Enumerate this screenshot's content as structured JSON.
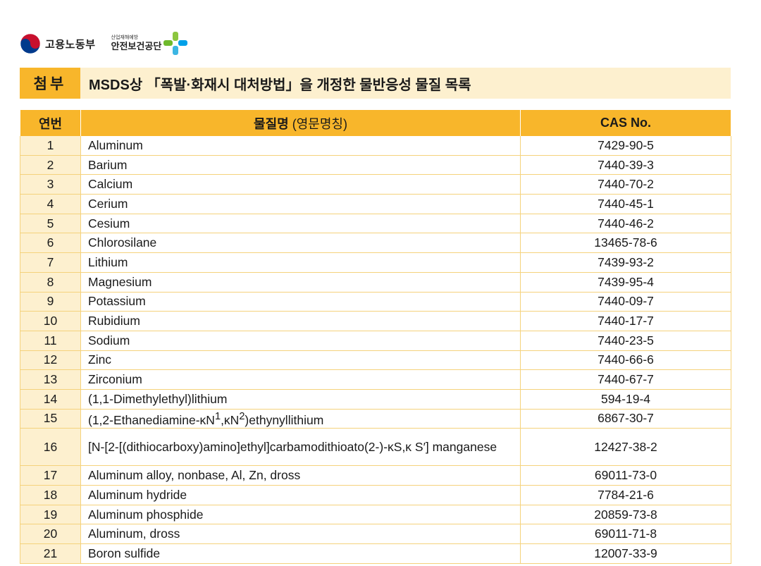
{
  "header": {
    "org1": "고용노동부",
    "org2_sub": "산업재해예방",
    "org2": "안전보건공단"
  },
  "title": {
    "tag": "첨부",
    "text": "MSDS상 「폭발·화재시 대처방법」을 개정한 물반응성 물질 목록"
  },
  "table": {
    "headers": {
      "no": "연번",
      "name_bold": "물질명",
      "name_rest": " (영문명칭)",
      "cas": "CAS No."
    },
    "rows": [
      {
        "no": "1",
        "name": "Aluminum",
        "cas": "7429-90-5"
      },
      {
        "no": "2",
        "name": "Barium",
        "cas": "7440-39-3"
      },
      {
        "no": "3",
        "name": "Calcium",
        "cas": "7440-70-2"
      },
      {
        "no": "4",
        "name": "Cerium",
        "cas": "7440-45-1"
      },
      {
        "no": "5",
        "name": "Cesium",
        "cas": "7440-46-2"
      },
      {
        "no": "6",
        "name": "Chlorosilane",
        "cas": "13465-78-6"
      },
      {
        "no": "7",
        "name": "Lithium",
        "cas": "7439-93-2"
      },
      {
        "no": "8",
        "name": "Magnesium",
        "cas": "7439-95-4"
      },
      {
        "no": "9",
        "name": "Potassium",
        "cas": "7440-09-7"
      },
      {
        "no": "10",
        "name": "Rubidium",
        "cas": "7440-17-7"
      },
      {
        "no": "11",
        "name": "Sodium",
        "cas": "7440-23-5"
      },
      {
        "no": "12",
        "name": "Zinc",
        "cas": "7440-66-6"
      },
      {
        "no": "13",
        "name": "Zirconium",
        "cas": "7440-67-7"
      },
      {
        "no": "14",
        "name": "(1,1-Dimethylethyl)lithium",
        "cas": "594-19-4"
      },
      {
        "no": "15",
        "name_html": "(1,2-Ethanediamine-κN<sup>1</sup>,κN<sup>2</sup>)ethynyllithium",
        "cas": "6867-30-7"
      },
      {
        "no": "16",
        "name": "[N-[2-[(dithiocarboxy)amino]ethyl]carbamodithioato(2-)-κS,κ S′] manganese",
        "cas": "12427-38-2",
        "tall": true
      },
      {
        "no": "17",
        "name": "Aluminum alloy, nonbase, Al, Zn, dross",
        "cas": "69011-73-0"
      },
      {
        "no": "18",
        "name": "Aluminum hydride",
        "cas": "7784-21-6"
      },
      {
        "no": "19",
        "name": "Aluminum phosphide",
        "cas": "20859-73-8"
      },
      {
        "no": "20",
        "name": "Aluminum, dross",
        "cas": "69011-71-8"
      },
      {
        "no": "21",
        "name": "Boron sulfide",
        "cas": "12007-33-9"
      }
    ]
  }
}
